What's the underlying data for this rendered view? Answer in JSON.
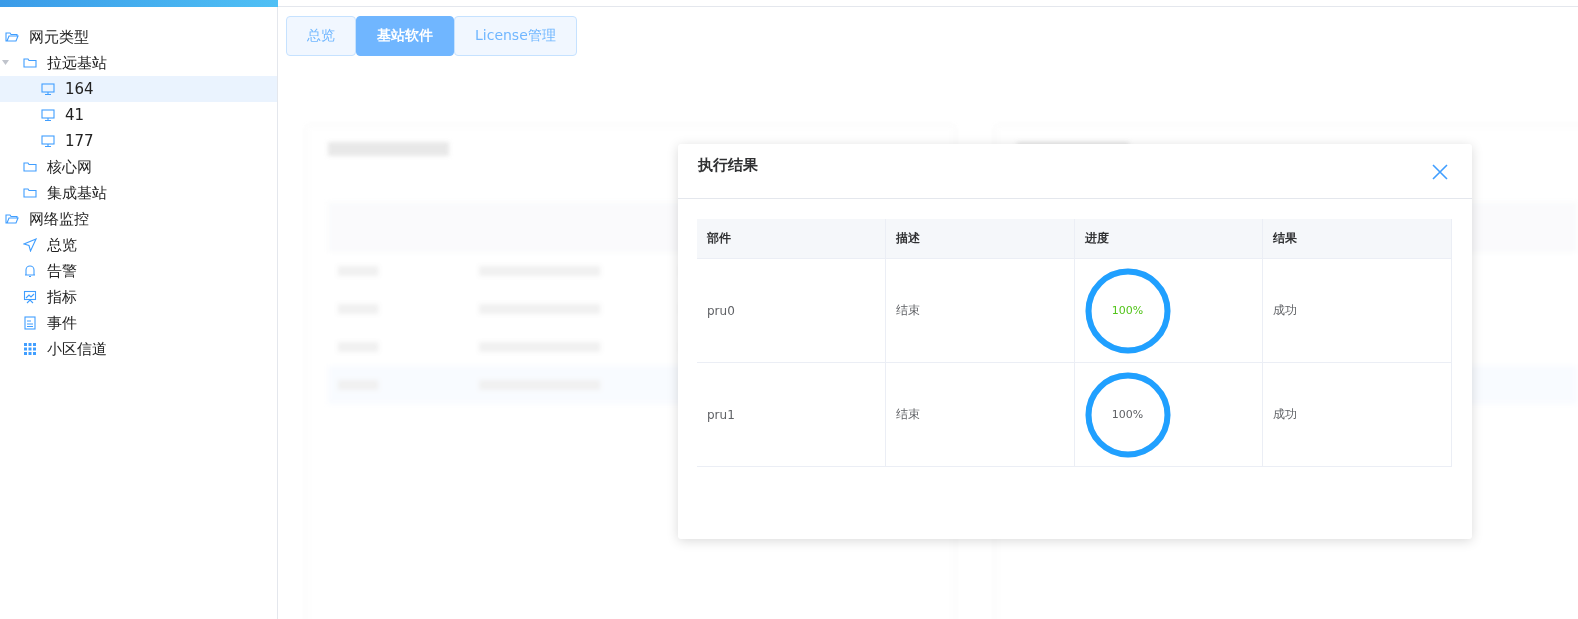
{
  "sidebar": {
    "tree": [
      {
        "label": "网元类型",
        "kind": "folder",
        "expanded": true,
        "selected": false,
        "children": [
          {
            "label": "拉远基站",
            "kind": "folder",
            "expanded": true,
            "selected": false,
            "children": [
              {
                "label": "164",
                "kind": "monitor",
                "selected": true
              },
              {
                "label": "41",
                "kind": "monitor",
                "selected": false
              },
              {
                "label": "177",
                "kind": "monitor",
                "selected": false
              }
            ]
          },
          {
            "label": "核心网",
            "kind": "folder",
            "expanded": false,
            "selected": false
          },
          {
            "label": "集成基站",
            "kind": "folder",
            "expanded": false,
            "selected": false
          }
        ]
      },
      {
        "label": "网络监控",
        "kind": "folder",
        "expanded": true,
        "selected": false,
        "children": [
          {
            "label": "总览",
            "kind": "navigate",
            "selected": false
          },
          {
            "label": "告警",
            "kind": "bell",
            "selected": false
          },
          {
            "label": "指标",
            "kind": "chart",
            "selected": false
          },
          {
            "label": "事件",
            "kind": "document",
            "selected": false
          },
          {
            "label": "小区信道",
            "kind": "grid",
            "selected": false
          }
        ]
      }
    ]
  },
  "tabs": [
    {
      "label": "总览",
      "selected": false
    },
    {
      "label": "基站软件",
      "selected": true
    },
    {
      "label": "License管理",
      "selected": false
    }
  ],
  "dialog": {
    "title": "执行结果",
    "columns": [
      "部件",
      "描述",
      "进度",
      "结果"
    ],
    "rows": [
      {
        "part": "pru0",
        "description": "结束",
        "progress": {
          "level": 1,
          "text": "100%",
          "color": "#52c41a"
        },
        "result": "成功"
      },
      {
        "part": "pru1",
        "description": "结束",
        "progress": {
          "level": 1,
          "text": "100%",
          "color": "#606266"
        },
        "result": "成功"
      }
    ]
  }
}
